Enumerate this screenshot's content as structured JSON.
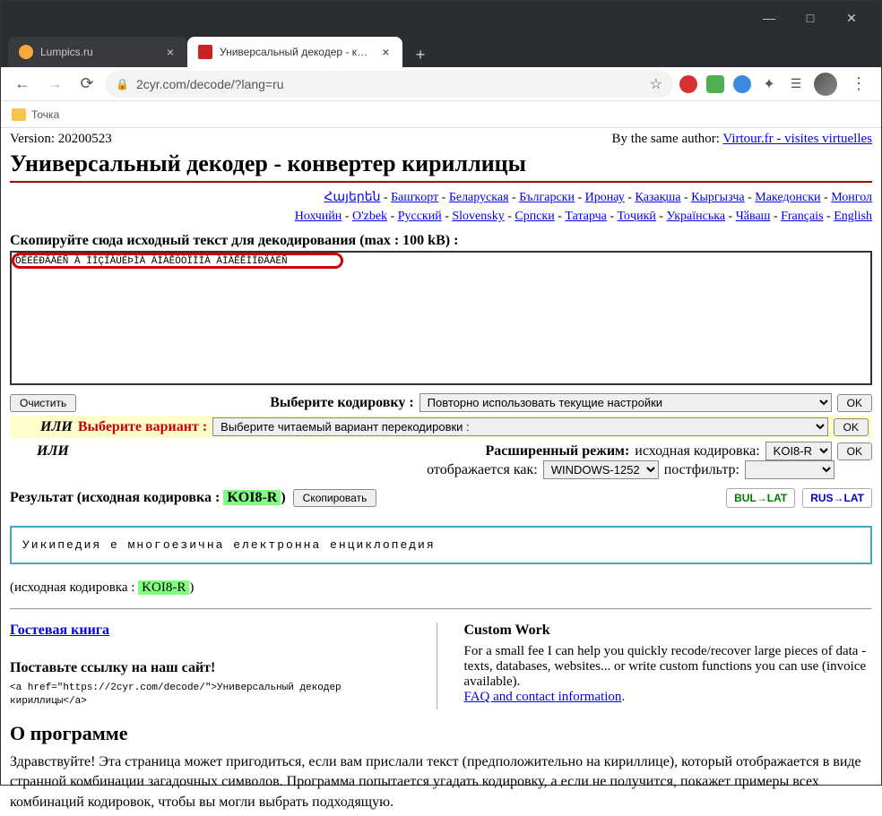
{
  "window": {
    "min": "—",
    "max": "□",
    "close": "✕"
  },
  "tabs": {
    "0": {
      "title": "Lumpics.ru"
    },
    "1": {
      "title": "Универсальный декодер - конве"
    },
    "add": "+"
  },
  "toolbar": {
    "url": "2cyr.com/decode/?lang=ru",
    "star": "☆"
  },
  "bookmarks": {
    "folder": "Точка"
  },
  "page": {
    "version_label": "Version: 20200523",
    "by_same": "By the same author: ",
    "virtour": "Virtour.fr - visites virtuelles",
    "h1": "Универсальный декодер - конвертер кириллицы",
    "langs": {
      "r1_0": "Հայերեն",
      "r1_1": "Башҡорт",
      "r1_2": "Беларуская",
      "r1_3": "Български",
      "r1_4": "Иронау",
      "r1_5": "Қазақша",
      "r1_6": "Кыргызча",
      "r1_7": "Македонски",
      "r1_8": "Монгол",
      "r2_0": "Нохчийн",
      "r2_1": "O'zbek",
      "r2_2": "Русский",
      "r2_3": "Slovensky",
      "r2_4": "Српски",
      "r2_5": "Татарча",
      "r2_6": "Тоҷикӣ",
      "r2_7": "Українська",
      "r2_8": "Чӑваш",
      "r2_9": "Français",
      "r2_10": "English"
    },
    "instruction": "Скопируйте сюда исходный текст для декодирования (max : 100 kB) :",
    "input_text": "ÓÊÉÉÐÄÀÉÑ À ÌÌÇÏÀÚÉÞÌÀ ÀÌÀÊÒÒÏÌÌÀ ÀÌÀÊÊÌÏÐÄÀÉÑ",
    "clear": "Очистить",
    "choose_enc": "Выберите кодировку :",
    "sel_reuse": "Повторно использовать текущие настройки",
    "ok": "OK",
    "or": "ИЛИ",
    "choose_variant": "Выберите вариант :",
    "sel_variant": "Выберите читаемый вариант перекодировки :",
    "adv_mode": "Расширенный режим:",
    "src_enc_label": " исходная кодировка:",
    "src_enc": "KOI8-R",
    "displayed_as": "отображается как:",
    "disp_enc": "WINDOWS-1252",
    "postfilter": " постфильтр:",
    "result_label": "Результат (исходная кодировка : ",
    "koi8": "KOI8-R",
    "paren": ")",
    "copy": "Скопировать",
    "bullat": "BUL→LAT",
    "ruslat": "RUS→LAT",
    "result_text": "Уикипедия е многоезична електронна енциклопедия",
    "src2": "(исходная кодировка : ",
    "guestbook": "Гостевая книга",
    "putlink": "Поставьте ссылку на наш сайт!",
    "snippet": "<a href=\"https://2cyr.com/decode/\">Универсальный декодер кириллицы</a>",
    "custom_h": "Custom Work",
    "custom_p": "For a small fee I can help you quickly recode/recover large pieces of data - texts, databases, websites... or write custom functions you can use (invoice available).",
    "faq": "FAQ and contact information",
    "about_h": "О программе",
    "about_p": "Здравствуйте! Эта страница может пригодиться, если вам прислали текст (предположительно на кириллице), который отображается в виде странной комбинации загадочных символов. Программа попытается угадать кодировку, а если не получится, покажет примеры всех комбинаций кодировок, чтобы вы могли выбрать подходящую."
  }
}
